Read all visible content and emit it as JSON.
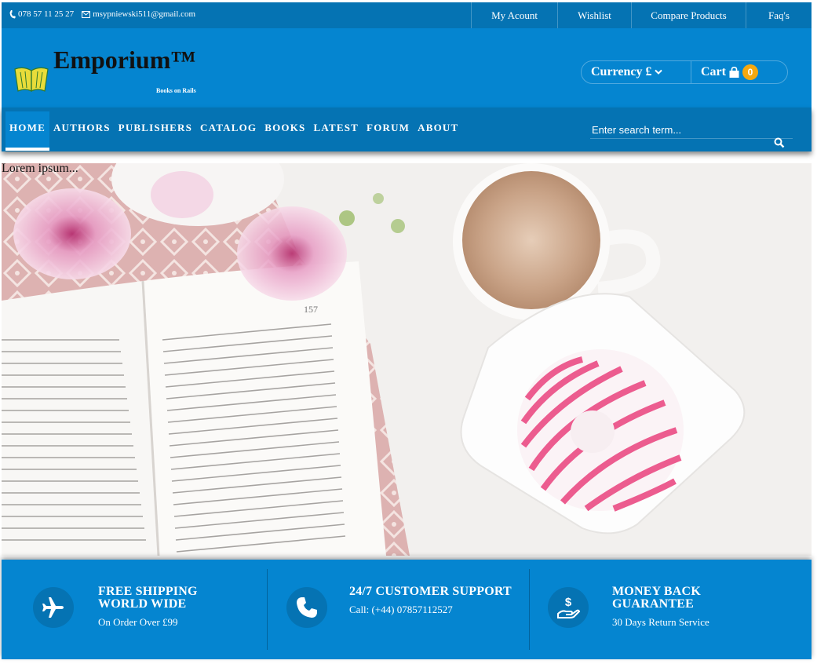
{
  "topbar": {
    "phone": "078 57 11 25 27",
    "email": "msypniewski511@gmail.com",
    "links": [
      "My Acount",
      "Wishlist",
      "Compare Products",
      "Faq's"
    ]
  },
  "header": {
    "brand": "Emporium™",
    "tagline": "Books on Rails",
    "currency_label": "Currency £",
    "cart_label": "Cart",
    "cart_count": "0"
  },
  "nav": {
    "items": [
      "HOME",
      "AUTHORS",
      "PUBLISHERS",
      "CATALOG",
      "BOOKS",
      "LATEST",
      "FORUM",
      "ABOUT"
    ],
    "active": "HOME",
    "search_placeholder": "Enter search term..."
  },
  "hero": {
    "text": "Lorem ipsum..."
  },
  "features": [
    {
      "title": "FREE SHIPPING WORLD WIDE",
      "subtitle": "On Order Over £99",
      "icon": "plane-icon"
    },
    {
      "title": "24/7 CUSTOMER SUPPORT",
      "subtitle": "Call: (+44) 07857112527",
      "icon": "phone-icon"
    },
    {
      "title": "MONEY BACK GUARANTEE",
      "subtitle": "30 Days Return Service",
      "icon": "money-hand-icon"
    }
  ],
  "colors": {
    "topbar": "#0573b3",
    "header": "#0585d0",
    "badge": "#f5a80f"
  }
}
